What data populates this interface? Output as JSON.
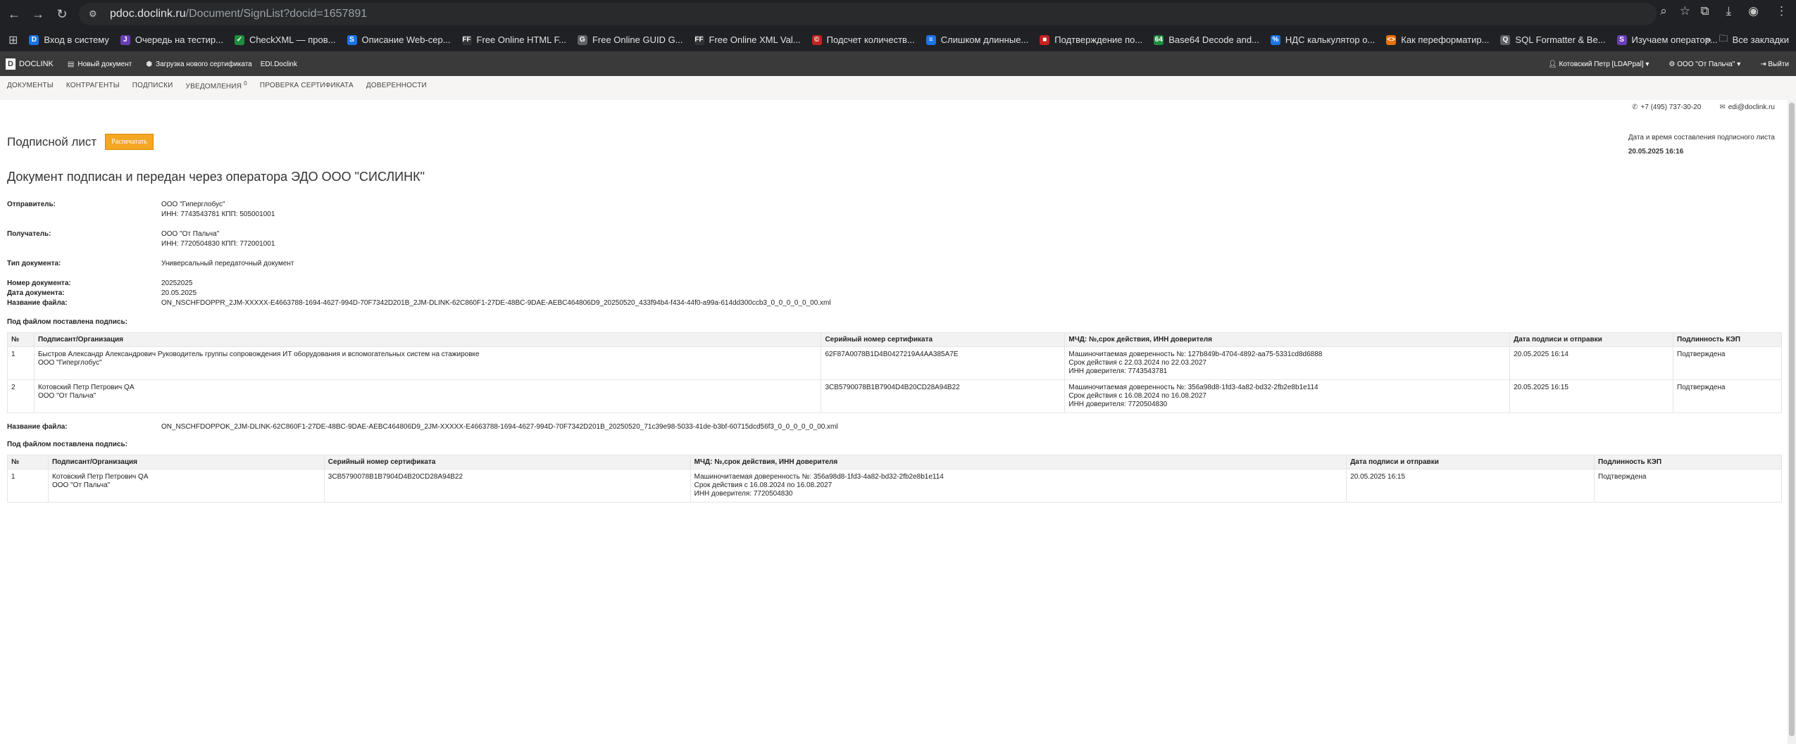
{
  "browser": {
    "url_host": "pdoc.doclink.ru",
    "url_path": "/Document/SignList?docid=1657891",
    "bookmarks": [
      {
        "label": "Вход в систему",
        "color": "#1a73e8",
        "glyph": "D"
      },
      {
        "label": "Очередь на тестир...",
        "color": "#6a3fb5",
        "glyph": "J"
      },
      {
        "label": "CheckXML — пров...",
        "color": "#1e8e3e",
        "glyph": "✓"
      },
      {
        "label": "Описание Web-сер...",
        "color": "#1a73e8",
        "glyph": "S"
      },
      {
        "label": "Free Online HTML F...",
        "color": "#333333",
        "glyph": "FF"
      },
      {
        "label": "Free Online GUID G...",
        "color": "#5f6368",
        "glyph": "G"
      },
      {
        "label": "Free Online XML Val...",
        "color": "#333333",
        "glyph": "FF"
      },
      {
        "label": "Подсчет количеств...",
        "color": "#c5221f",
        "glyph": "©"
      },
      {
        "label": "Слишком длинные...",
        "color": "#1a73e8",
        "glyph": "≡"
      },
      {
        "label": "Подтверждение по...",
        "color": "#c5221f",
        "glyph": "■"
      },
      {
        "label": "Base64 Decode and...",
        "color": "#1e8e3e",
        "glyph": "64"
      },
      {
        "label": "НДС калькулятор о...",
        "color": "#1a73e8",
        "glyph": "%"
      },
      {
        "label": "Как переформатир...",
        "color": "#e8710a",
        "glyph": "<>"
      },
      {
        "label": "SQL Formatter & Be...",
        "color": "#5f6368",
        "glyph": "Q"
      },
      {
        "label": "Изучаем оператор...",
        "color": "#6a3fb5",
        "glyph": "S"
      }
    ],
    "all_bookmarks": "Все закладки"
  },
  "appbar": {
    "logo": "DOCLINK",
    "items": [
      "Новый документ",
      "Загрузка нового сертификата",
      "EDI.Doclink"
    ],
    "user": "Котовский Петр [LDAPpal]",
    "org": "ООО \"От Пальча\"",
    "logout": "Выйти"
  },
  "subnav": {
    "items": [
      "ДОКУМЕНТЫ",
      "КОНТРАГЕНТЫ",
      "ПОДПИСКИ",
      "УВЕДОМЛЕНИЯ",
      "ПРОВЕРКА СЕРТИФИКАТА",
      "ДОВЕРЕННОСТИ"
    ],
    "notifications_count": "0"
  },
  "contacts": {
    "phone": "+7 (495) 737-30-20",
    "email": "edi@doclink.ru"
  },
  "page": {
    "title": "Подписной лист",
    "print_button": "Распечатать",
    "date_label": "Дата и время составления подписного листа",
    "date_value": "20.05.2025 16:16",
    "subtitle": "Документ подписан и передан через оператора ЭДО ООО \"СИСЛИНК\""
  },
  "document": {
    "sender_label": "Отправитель:",
    "sender_name": "ООО \"Гиперглобус\"",
    "sender_ids": "ИНН: 7743543781 КПП: 505001001",
    "receiver_label": "Получатель:",
    "receiver_name": "ООО \"От Пальча\"",
    "receiver_ids": "ИНН: 7720504830 КПП: 772001001",
    "type_label": "Тип документа:",
    "type_value": "Универсальный передаточный документ",
    "number_label": "Номер документа:",
    "number_value": "20252025",
    "date_label": "Дата документа:",
    "date_value": "20.05.2025",
    "file_label": "Название файла:",
    "file1": "ON_NSCHFDOPPR_2JM-XXXXX-E4663788-1694-4627-994D-70F7342D201B_2JM-DLINK-62C860F1-27DE-48BC-9DAE-AEBC464806D9_20250520_433f94b4-f434-44f0-a99a-614dd300ccb3_0_0_0_0_0_00.xml",
    "file2": "ON_NSCHFDOPPOK_2JM-DLINK-62C860F1-27DE-48BC-9DAE-AEBC464806D9_2JM-XXXXX-E4663788-1694-4627-994D-70F7342D201B_20250520_71c39e98-5033-41de-b3bf-60715dcd56f3_0_0_0_0_0_00.xml",
    "signed_label": "Под файлом поставлена подпись:"
  },
  "table_headers": {
    "num": "№",
    "signer": "Подписант/Организация",
    "serial": "Серийный номер сертификата",
    "mchd": "МЧД: №,срок действия, ИНН доверителя",
    "date": "Дата подписи и отправки",
    "valid": "Подлинность КЭП"
  },
  "table1": [
    {
      "num": "1",
      "signer": "Быстров Александр Александрович   Руководитель группы сопровождения ИТ оборудования и вспомогательных систем на стажировке",
      "org": "ООО \"Гиперглобус\"",
      "serial": "62F87A0078B1D4B0427219A4AA385A7E",
      "mchd1": "Машиночитаемая доверенность №: 127b849b-4704-4892-aa75-5331cd8d6888",
      "mchd2": "Срок действия с 22.03.2024 по 22.03.2027",
      "mchd3": "ИНН доверителя: 7743543781",
      "date": "20.05.2025 16:14",
      "valid": "Подтверждена"
    },
    {
      "num": "2",
      "signer": "Котовский Петр Петрович   QA",
      "org": "ООО \"От Пальча\"",
      "serial": "3CB5790078B1B7904D4B20CD28A94B22",
      "mchd1": "Машиночитаемая доверенность №: 356a98d8-1fd3-4a82-bd32-2fb2e8b1e114",
      "mchd2": "Срок действия с 16.08.2024 по 16.08.2027",
      "mchd3": "ИНН доверителя: 7720504830",
      "date": "20.05.2025 16:15",
      "valid": "Подтверждена"
    }
  ],
  "table2": [
    {
      "num": "1",
      "signer": "Котовский Петр Петрович   QA",
      "org": "ООО \"От Пальча\"",
      "serial": "3CB5790078B1B7904D4B20CD28A94B22",
      "mchd1": "Машиночитаемая доверенность №: 356a98d8-1fd3-4a82-bd32-2fb2e8b1e114",
      "mchd2": "Срок действия с 16.08.2024 по 16.08.2027",
      "mchd3": "ИНН доверителя: 7720504830",
      "date": "20.05.2025 16:15",
      "valid": "Подтверждена"
    }
  ]
}
